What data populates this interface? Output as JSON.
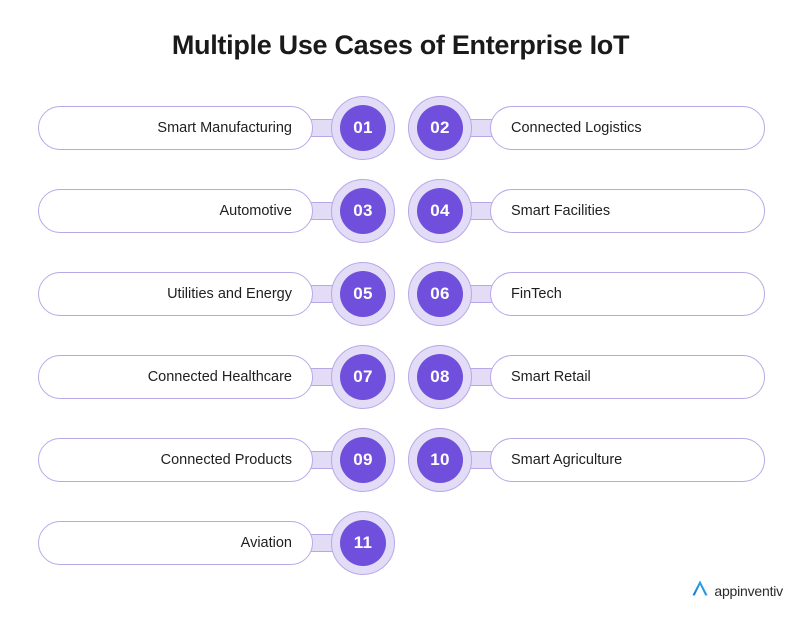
{
  "title": "Multiple Use Cases of Enterprise IoT",
  "colors": {
    "accent_purple": "#6f4fdb",
    "ring_lavender": "#e2dcf7",
    "border_purple": "#b9a8e8",
    "text_dark": "#1f1f1f",
    "background": "#ffffff",
    "logo_blue": "#1f9cf0"
  },
  "rows": [
    {
      "left": {
        "number": "01",
        "label": "Smart Manufacturing"
      },
      "right": {
        "number": "02",
        "label": "Connected Logistics"
      }
    },
    {
      "left": {
        "number": "03",
        "label": "Automotive"
      },
      "right": {
        "number": "04",
        "label": "Smart Facilities"
      }
    },
    {
      "left": {
        "number": "05",
        "label": "Utilities and Energy"
      },
      "right": {
        "number": "06",
        "label": "FinTech"
      }
    },
    {
      "left": {
        "number": "07",
        "label": "Connected Healthcare"
      },
      "right": {
        "number": "08",
        "label": "Smart Retail"
      }
    },
    {
      "left": {
        "number": "09",
        "label": "Connected Products"
      },
      "right": {
        "number": "10",
        "label": "Smart Agriculture"
      }
    },
    {
      "left": {
        "number": "11",
        "label": "Aviation"
      },
      "right": null
    }
  ],
  "logo": {
    "mark": "appinventiv-a-icon",
    "text": "appinventiv"
  }
}
